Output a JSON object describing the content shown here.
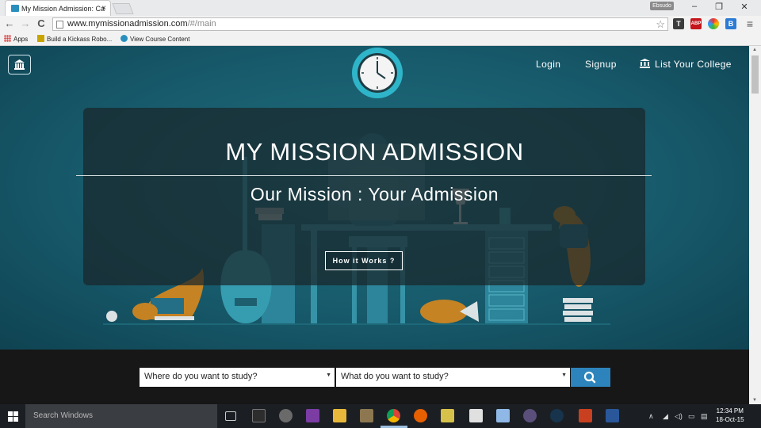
{
  "browser": {
    "tab_title": "My Mission Admission: Ca",
    "tab_close": "×",
    "url_host": "www.mymissionadmission.com",
    "url_path": "/#/main",
    "user_badge": "Ebsudo",
    "window_controls": {
      "minimize": "–",
      "maximize": "❐",
      "close": "✕"
    },
    "nav": {
      "back": "←",
      "forward": "→",
      "reload": "C",
      "bookmark_star": "☆",
      "menu": "≡"
    },
    "extensions": [
      {
        "name": "T",
        "color": "#3c3c3c"
      },
      {
        "name": "ABP",
        "color": "#c4161c"
      },
      {
        "name": "",
        "color": "#e9a100"
      },
      {
        "name": "B",
        "color": "#2c7bd4"
      }
    ],
    "bookmarks": [
      {
        "label": "Apps",
        "icon": "apps-grid-icon",
        "color": "#d44"
      },
      {
        "label": "Build a Kickass Robo...",
        "icon": "instructables-icon",
        "color": "#c8a400"
      },
      {
        "label": "View Course Content",
        "icon": "graduation-cap-icon",
        "color": "#2a8fbd"
      }
    ]
  },
  "site": {
    "nav": {
      "login": "Login",
      "signup": "Signup",
      "list_college": "List Your College"
    },
    "hero": {
      "title": "MY MISSION ADMISSION",
      "subtitle": "Our Mission : Your Admission",
      "cta": "How it Works ?"
    },
    "search": {
      "where_placeholder": "Where do you want to study?",
      "what_placeholder": "What do you want to study?",
      "caret": "▼"
    },
    "colors": {
      "hero_bg": "#175a6b",
      "search_button": "#2d84bc",
      "clock_ring": "#2fb5c9"
    }
  },
  "taskbar": {
    "search_placeholder": "Search Windows",
    "time": "12:34 PM",
    "date": "18-Oct-15"
  }
}
